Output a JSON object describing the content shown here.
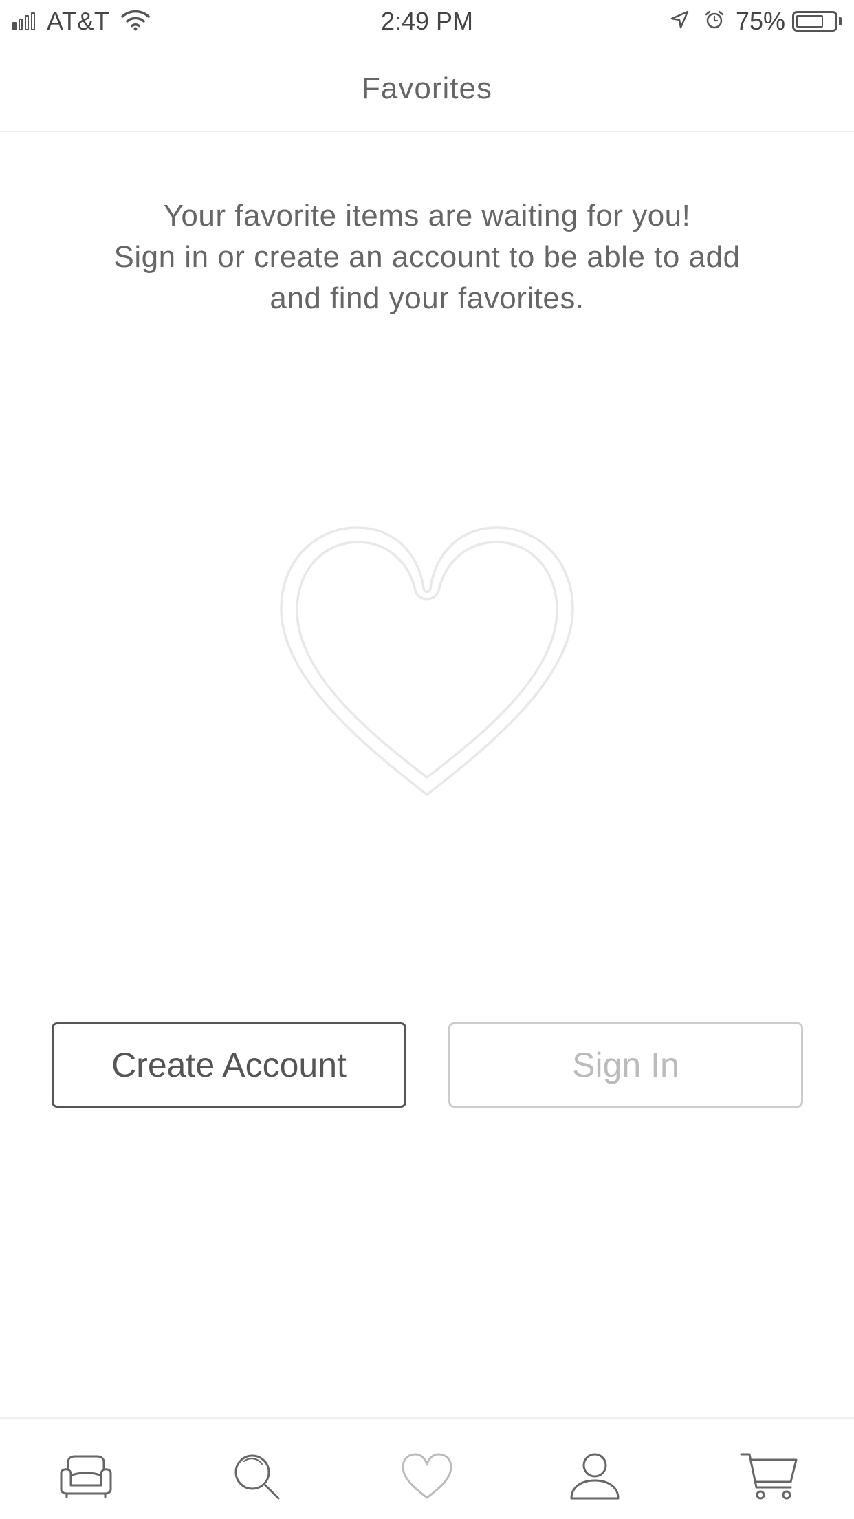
{
  "status_bar": {
    "carrier": "AT&T",
    "time": "2:49 PM",
    "battery_percent": "75%",
    "battery_level": 0.75,
    "signal_bars_filled": 1,
    "signal_bars_total": 4,
    "icons": [
      "signal-icon",
      "wifi-icon",
      "location-arrow-icon",
      "alarm-icon",
      "battery-icon"
    ]
  },
  "header": {
    "title": "Favorites"
  },
  "empty_state": {
    "line1": "Your favorite items are waiting for you!",
    "line2": "Sign in or create an account to be able to add",
    "line3": "and find your favorites.",
    "illustration": "heart-outline-icon"
  },
  "actions": {
    "create_account_label": "Create Account",
    "sign_in_label": "Sign In"
  },
  "tab_bar": {
    "tabs": [
      {
        "icon": "sofa-icon",
        "active": false
      },
      {
        "icon": "search-icon",
        "active": false
      },
      {
        "icon": "heart-icon",
        "active": true
      },
      {
        "icon": "account-icon",
        "active": false
      },
      {
        "icon": "cart-icon",
        "active": false
      }
    ]
  },
  "colors": {
    "text": "#666666",
    "button_border": "#555555",
    "disabled_button": "#cccccc",
    "divider": "#eeeeee"
  }
}
